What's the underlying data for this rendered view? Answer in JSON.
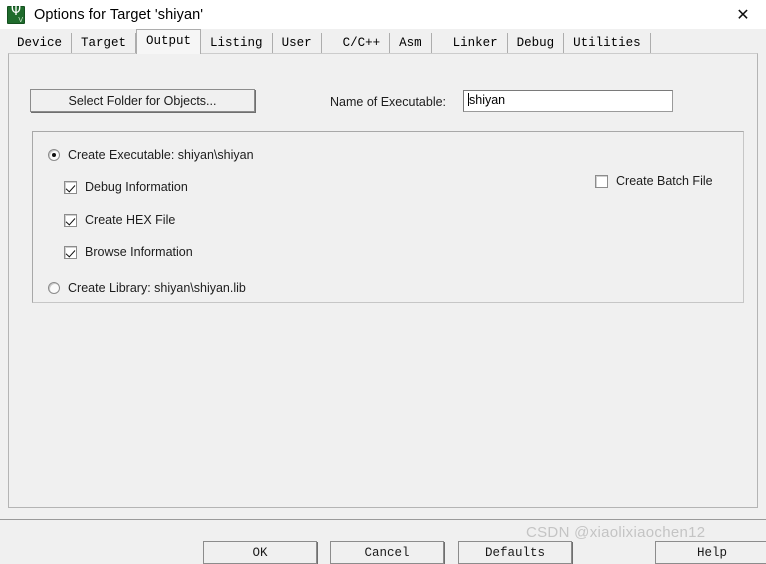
{
  "window": {
    "title": "Options for Target 'shiyan'",
    "icon": "keil-uvision-icon",
    "close_label": "✕"
  },
  "tabs": [
    {
      "label": "Device",
      "selected": false
    },
    {
      "label": "Target",
      "selected": false
    },
    {
      "label": "Output",
      "selected": true
    },
    {
      "label": "Listing",
      "selected": false
    },
    {
      "label": "User",
      "selected": false
    },
    {
      "label": "C/C++",
      "selected": false
    },
    {
      "label": "Asm",
      "selected": false
    },
    {
      "label": "Linker",
      "selected": false
    },
    {
      "label": "Debug",
      "selected": false
    },
    {
      "label": "Utilities",
      "selected": false
    }
  ],
  "output_page": {
    "select_folder_button": "Select Folder for Objects...",
    "executable_name_label": "Name of Executable:",
    "executable_name_value": "shiyan",
    "executable_name_placeholder": "",
    "create_executable": {
      "label": "Create Executable:  shiyan\\shiyan",
      "checked": true
    },
    "debug_information": {
      "label": "Debug Information",
      "checked": true
    },
    "create_hex_file": {
      "label": "Create HEX File",
      "checked": true
    },
    "browse_information": {
      "label": "Browse Information",
      "checked": true
    },
    "create_library": {
      "label": "Create Library:  shiyan\\shiyan.lib",
      "checked": false
    },
    "create_batch_file": {
      "label": "Create Batch File",
      "checked": false
    }
  },
  "footer": {
    "ok_label": "OK",
    "cancel_label": "Cancel",
    "defaults_label": "Defaults",
    "help_label": "Help"
  },
  "watermark": "CSDN @xiaolixiaochen12",
  "colors": {
    "dialog_bg": "#f0f0f0",
    "titlebar_bg": "#ffffff",
    "field_bg": "#ffffff",
    "border": "#8c8c8c",
    "text": "#1d1d1d",
    "app_icon_green": "#1f6b2c",
    "watermark": "#c4c4c4"
  }
}
